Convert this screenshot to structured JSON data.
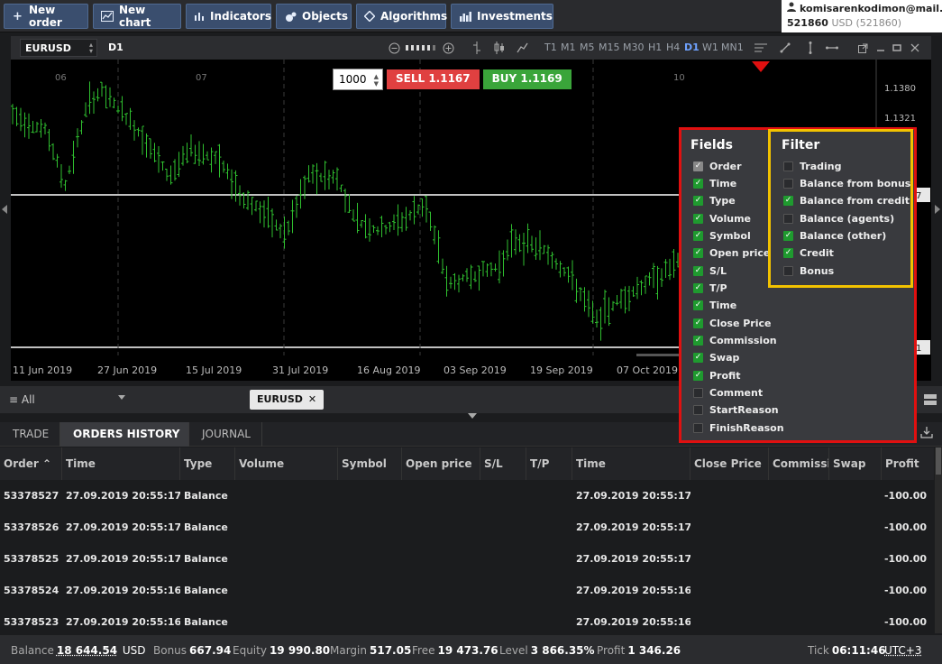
{
  "toolbar": {
    "buttons": [
      {
        "label": "New order",
        "icon": "plus-icon"
      },
      {
        "label": "New chart",
        "icon": "chart-icon"
      },
      {
        "label": "Indicators",
        "icon": "indicators-icon"
      },
      {
        "label": "Objects",
        "icon": "objects-icon"
      },
      {
        "label": "Algorithms",
        "icon": "algorithms-icon"
      },
      {
        "label": "Investments",
        "icon": "investments-icon"
      }
    ]
  },
  "account": {
    "email": "komisarenkodimon@mail.ru",
    "id": "521860",
    "currency": "USD",
    "id_paren": "(521860)"
  },
  "chart": {
    "symbol": "EURUSD",
    "period": "D1",
    "timeframes": [
      "T1",
      "M1",
      "M5",
      "M15",
      "M30",
      "H1",
      "H4",
      "D1",
      "W1",
      "MN1"
    ],
    "active_timeframe": "D1",
    "lot": "1000",
    "sell_label": "SELL",
    "sell_price": "1.1167",
    "buy_label": "BUY",
    "buy_price": "1.1169",
    "price_labels": [
      "1.1380",
      "1.1321"
    ],
    "price_tags": [
      "7",
      "1"
    ],
    "month_markers": [
      "06",
      "07",
      "10"
    ],
    "date_labels": [
      "11 Jun 2019",
      "27 Jun 2019",
      "15 Jul 2019",
      "31 Jul 2019",
      "16 Aug 2019",
      "03 Sep 2019",
      "19 Sep 2019",
      "07 Oct 2019"
    ],
    "bar_color": "#2fbf2f"
  },
  "panel": {
    "filter_label": "≡ All",
    "symbol_chip": "EURUSD",
    "tabs": [
      "TRADE",
      "ORDERS HISTORY",
      "JOURNAL"
    ],
    "active_tab": "ORDERS HISTORY"
  },
  "table": {
    "columns": [
      "Order ⌃",
      "Time",
      "Type",
      "Volume",
      "Symbol",
      "Open price",
      "S/L",
      "T/P",
      "Time",
      "Close Price",
      "Commissi",
      "Swap",
      "Profit"
    ],
    "rows": [
      {
        "order": "53378527",
        "time": "27.09.2019 20:55:17",
        "type": "Balance",
        "close_time": "27.09.2019 20:55:17",
        "profit": "-100.00"
      },
      {
        "order": "53378526",
        "time": "27.09.2019 20:55:17",
        "type": "Balance",
        "close_time": "27.09.2019 20:55:17",
        "profit": "-100.00"
      },
      {
        "order": "53378525",
        "time": "27.09.2019 20:55:17",
        "type": "Balance",
        "close_time": "27.09.2019 20:55:17",
        "profit": "-100.00"
      },
      {
        "order": "53378524",
        "time": "27.09.2019 20:55:16",
        "type": "Balance",
        "close_time": "27.09.2019 20:55:16",
        "profit": "-100.00"
      },
      {
        "order": "53378523",
        "time": "27.09.2019 20:55:16",
        "type": "Balance",
        "close_time": "27.09.2019 20:55:16",
        "profit": "-100.00"
      }
    ]
  },
  "status": {
    "balance_label": "Balance",
    "balance": "18 644.54",
    "balance_cur": "USD",
    "bonus_label": "Bonus",
    "bonus": "667.94",
    "equity_label": "Equity",
    "equity": "19 990.80",
    "margin_label": "Margin",
    "margin": "517.05",
    "free_label": "Free",
    "free": "19 473.76",
    "level_label": "Level",
    "level": "3 866.35%",
    "profit_label": "Profit",
    "profit": "1 346.26",
    "tick_label": "Tick",
    "tick": "06:11:46",
    "tz": "UTC+3"
  },
  "popup": {
    "fields_title": "Fields",
    "fields": [
      {
        "label": "Order",
        "state": "locked"
      },
      {
        "label": "Time",
        "state": "on"
      },
      {
        "label": "Type",
        "state": "on"
      },
      {
        "label": "Volume",
        "state": "on"
      },
      {
        "label": "Symbol",
        "state": "on"
      },
      {
        "label": "Open price",
        "state": "on"
      },
      {
        "label": "S/L",
        "state": "on"
      },
      {
        "label": "T/P",
        "state": "on"
      },
      {
        "label": "Time",
        "state": "on"
      },
      {
        "label": "Close Price",
        "state": "on"
      },
      {
        "label": "Commission",
        "state": "on"
      },
      {
        "label": "Swap",
        "state": "on"
      },
      {
        "label": "Profit",
        "state": "on"
      },
      {
        "label": "Comment",
        "state": "off"
      },
      {
        "label": "StartReason",
        "state": "off"
      },
      {
        "label": "FinishReason",
        "state": "off"
      }
    ],
    "filter_title": "Filter",
    "filters": [
      {
        "label": "Trading",
        "state": "off"
      },
      {
        "label": "Balance from bonus",
        "state": "off"
      },
      {
        "label": "Balance from credit",
        "state": "on"
      },
      {
        "label": "Balance (agents)",
        "state": "off"
      },
      {
        "label": "Balance (other)",
        "state": "on"
      },
      {
        "label": "Credit",
        "state": "on"
      },
      {
        "label": "Bonus",
        "state": "off"
      }
    ]
  }
}
